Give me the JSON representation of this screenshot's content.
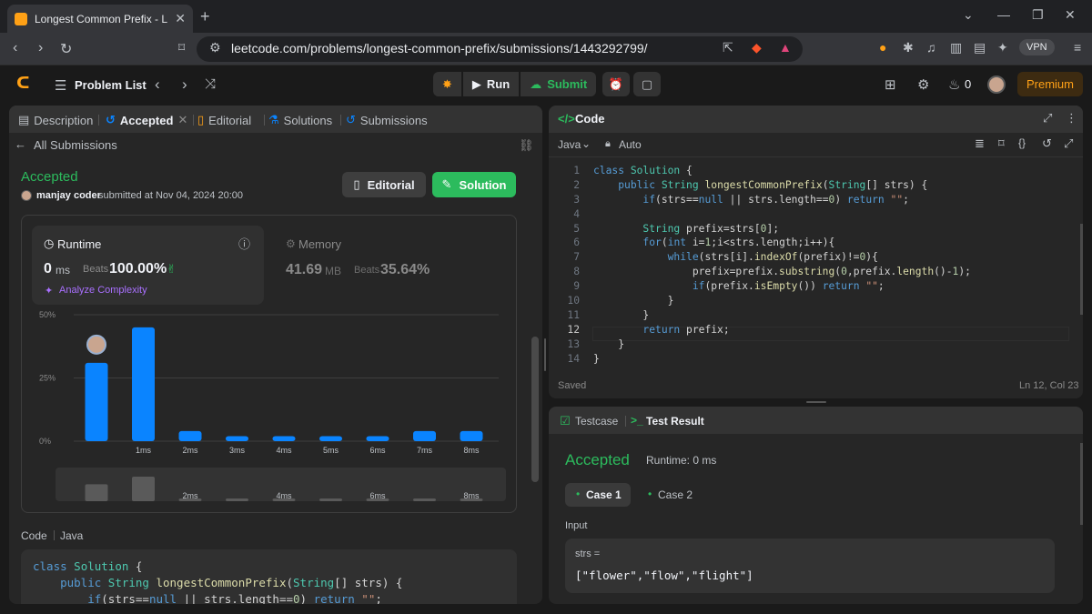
{
  "browser": {
    "tab_title": "Longest Common Prefix - LeetC",
    "url": "leetcode.com/problems/longest-common-prefix/submissions/1443292799/",
    "vpn_label": "VPN"
  },
  "nav": {
    "problem_list": "Problem List",
    "run": "Run",
    "submit": "Submit",
    "streak": "0",
    "premium": "Premium"
  },
  "left_tabs": {
    "description": "Description",
    "accepted": "Accepted",
    "editorial": "Editorial",
    "solutions": "Solutions",
    "submissions": "Submissions"
  },
  "submission": {
    "back_label": "All Submissions",
    "status": "Accepted",
    "user": "manjay coder",
    "submitted_at": "submitted at Nov 04, 2024 20:00",
    "editorial_btn": "Editorial",
    "solution_btn": "Solution",
    "runtime_label": "Runtime",
    "runtime_value": "0",
    "runtime_unit": "ms",
    "beats_label": "Beats",
    "runtime_beats": "100.00%",
    "analyze": "Analyze Complexity",
    "memory_label": "Memory",
    "memory_value": "41.69",
    "memory_unit": "MB",
    "memory_beats": "35.64%",
    "code_label": "Code",
    "code_lang": "Java"
  },
  "chart_data": {
    "type": "bar",
    "categories": [
      "",
      "1ms",
      "2ms",
      "3ms",
      "4ms",
      "5ms",
      "6ms",
      "7ms",
      "8ms"
    ],
    "values": [
      31,
      45,
      4,
      2,
      2,
      2,
      2,
      4,
      4
    ],
    "ylim": [
      0,
      50
    ],
    "yticks": [
      "50%",
      "25%",
      "0%"
    ],
    "highlight_index": 0,
    "colors": {
      "bar": "#0a84ff",
      "grid": "#3e3e3e"
    },
    "minimap_labels": [
      "2ms",
      "4ms",
      "6ms",
      "8ms"
    ]
  },
  "editor": {
    "title": "Code",
    "lang": "Java",
    "mode": "Auto",
    "saved": "Saved",
    "cursor": "Ln 12, Col 23",
    "line_numbers": [
      "1",
      "2",
      "3",
      "4",
      "5",
      "6",
      "7",
      "8",
      "9",
      "10",
      "11",
      "12",
      "13",
      "14"
    ]
  },
  "left_code_preview": {
    "line1": "class Solution {",
    "line2": "    public String longestCommonPrefix(String[] strs) {",
    "line3": "        if(strs==null || strs.length==0) return \"\";"
  },
  "result": {
    "testcase_tab": "Testcase",
    "result_tab": "Test Result",
    "status": "Accepted",
    "runtime": "Runtime: 0 ms",
    "case1": "Case 1",
    "case2": "Case 2",
    "input_label": "Input",
    "var_name": "strs =",
    "var_value": "[\"flower\",\"flow\",\"flight\"]"
  }
}
